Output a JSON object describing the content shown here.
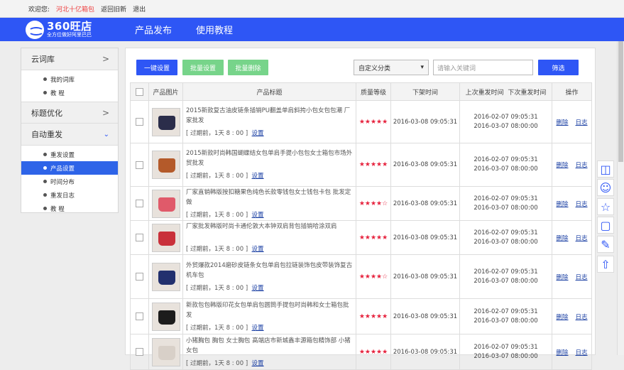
{
  "topbar": {
    "welcome": "欢迎您:",
    "user": "河北十亿箱包",
    "back": "返回旧新",
    "logout": "退出"
  },
  "header": {
    "logo_main": "360旺店",
    "logo_sub": "全方位做好阿里巴巴",
    "nav": [
      "产品发布",
      "使用教程"
    ]
  },
  "sidebar": {
    "sections": [
      {
        "label": "云词库",
        "items": [
          "我的词库",
          "教 程"
        ]
      },
      {
        "label": "标题优化",
        "items": []
      },
      {
        "label": "自动重发",
        "items": [
          "重发设置",
          "产品设置",
          "时间分布",
          "重发日志",
          "教 程"
        ]
      }
    ],
    "active_item": "产品设置"
  },
  "toolbar": {
    "btn_settings": "一键设置",
    "btn_batch_settings": "批量设置",
    "btn_batch_delete": "批量删除",
    "category": "自定义分类",
    "search_placeholder": "请输入关键词",
    "filter": "筛选"
  },
  "table": {
    "headers": [
      "产品图片",
      "产品标题",
      "质量等级",
      "下架时间",
      "上次重发时间",
      "下次重发时间",
      "操作"
    ],
    "rows": [
      {
        "title": "2015新款复古油皮链条插销PU翻盖单肩斜挎小包女包包潮 厂家批发",
        "meta": "[ 过期前，1天 8 : 00 ]",
        "link": "设置",
        "stars": "★★★★★",
        "offline": "2016-03-08 09:05:31",
        "last": "2016-02-07 09:05:31",
        "next": "2016-03-07 08:00:00",
        "op1": "删除",
        "op2": "日志",
        "color": "#2b2d4a"
      },
      {
        "title": "2015新款时尚韩国蝴蝶结女包单肩手提小包包女士箱包市场外贸批发",
        "meta": "[ 过期前，1天 8 : 00 ]",
        "link": "设置",
        "stars": "★★★★★",
        "offline": "2016-03-08 09:05:31",
        "last": "2016-02-07 09:05:31",
        "next": "2016-03-07 08:00:00",
        "op1": "删除",
        "op2": "日志",
        "color": "#b45a2a"
      },
      {
        "title": "厂家直销韩版按扣糖果色纯色长款零钱包女士钱包卡包 批发定做",
        "meta": "[ 过期前，1天 8 : 00 ]",
        "link": "设置",
        "stars": "★★★★☆",
        "offline": "2016-03-08 09:05:31",
        "last": "2016-02-07 09:05:31",
        "next": "2016-03-07 08:00:00",
        "op1": "删除",
        "op2": "日志",
        "color": "#e05a6a"
      },
      {
        "title": "厂家批发韩版时尚卡通伦敦大本钟双肩背包插销哈涂双肩",
        "meta": "[ 过期前，1天 8 : 00 ]",
        "link": "设置",
        "stars": "★★★★★",
        "offline": "2016-03-08 09:05:31",
        "last": "2016-02-07 09:05:31",
        "next": "2016-03-07 08:00:00",
        "op1": "删除",
        "op2": "日志",
        "color": "#c9303a"
      },
      {
        "title": "外贸爆款2014磨砂皮链条女包单肩包拉链装饰包皮带装饰复古机车包",
        "meta": "[ 过期前，1天 8 : 00 ]",
        "link": "设置",
        "stars": "★★★★☆",
        "offline": "2016-03-08 09:05:31",
        "last": "2016-02-07 09:05:31",
        "next": "2016-03-07 08:00:00",
        "op1": "删除",
        "op2": "日志",
        "color": "#22306e"
      },
      {
        "title": "新款包包韩版印花女包单肩包圆筒手提包时尚韩和女士箱包批发",
        "meta": "[ 过期前，1天 8 : 00 ]",
        "link": "设置",
        "stars": "★★★★★",
        "offline": "2016-03-08 09:05:31",
        "last": "2016-02-07 09:05:31",
        "next": "2016-03-07 08:00:00",
        "op1": "删除",
        "op2": "日志",
        "color": "#1c1c1c"
      },
      {
        "title": "小猪胸包 胸包 女士胸包 高端店市新城鑫丰源箱包精饰部 小猪女包",
        "meta": "[ 过期前，1天 8 : 00 ]",
        "link": "设置",
        "stars": "★★★★★",
        "offline": "2016-03-08 09:05:31",
        "last": "2016-02-07 09:05:31",
        "next": "2016-03-07 08:00:00",
        "op1": "删除",
        "op2": "日志",
        "color": "#d8d0c8"
      }
    ]
  },
  "float_icons": [
    "chat-icon",
    "smiley-icon",
    "star-icon",
    "screen-icon",
    "pen-icon",
    "top-icon"
  ]
}
